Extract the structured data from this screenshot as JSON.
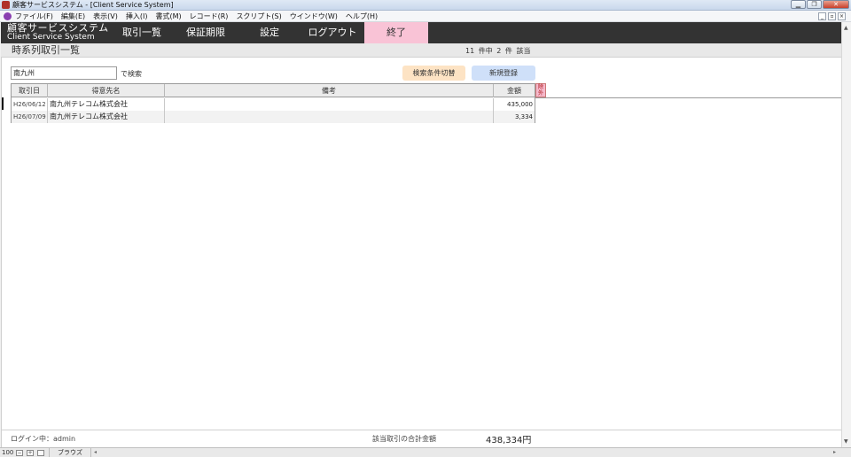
{
  "titlebar": {
    "title": "顧客サービスシステム - [Client Service System]",
    "minimize_icon": "minimize-icon",
    "maximize_icon": "restore-icon",
    "close_icon": "close-icon"
  },
  "menubar": {
    "items": [
      "ファイル(F)",
      "編集(E)",
      "表示(V)",
      "挿入(I)",
      "書式(M)",
      "レコード(R)",
      "スクリプト(S)",
      "ウインドウ(W)",
      "ヘルプ(H)"
    ],
    "mdi": [
      "_",
      "▫",
      "×"
    ]
  },
  "logo": {
    "jp": "顧客サービスシステム",
    "en": "Client Service System"
  },
  "nav": {
    "tabs": [
      "取引一覧",
      "保証期限",
      "設定",
      "ログアウト"
    ],
    "exit": "終了",
    "exit_color": "#f9c3d6"
  },
  "page": {
    "title": "時系列取引一覧",
    "count": "11 件中 2 件 該当"
  },
  "search": {
    "value": "南九州",
    "suffix": "で検索",
    "toggle_button": "検索条件切替",
    "new_button": "新規登録"
  },
  "table": {
    "headers": {
      "date": "取引日",
      "customer": "得意先名",
      "memo": "備考",
      "amount": "金額"
    },
    "exclude_label": "除外",
    "rows": [
      {
        "date": "H26/06/12",
        "customer": "南九州テレコム株式会社",
        "memo": "",
        "amount": "435,000"
      },
      {
        "date": "H26/07/09",
        "customer": "南九州テレコム株式会社",
        "memo": "",
        "amount": "3,334"
      }
    ]
  },
  "footer": {
    "login": "ログイン中：admin",
    "total_label": "該当取引の合計金額",
    "total_value": "438,334円"
  },
  "statusbar": {
    "zoom": "100",
    "zoom_out": "−",
    "zoom_in": "+",
    "mode": "ブラウズ"
  }
}
